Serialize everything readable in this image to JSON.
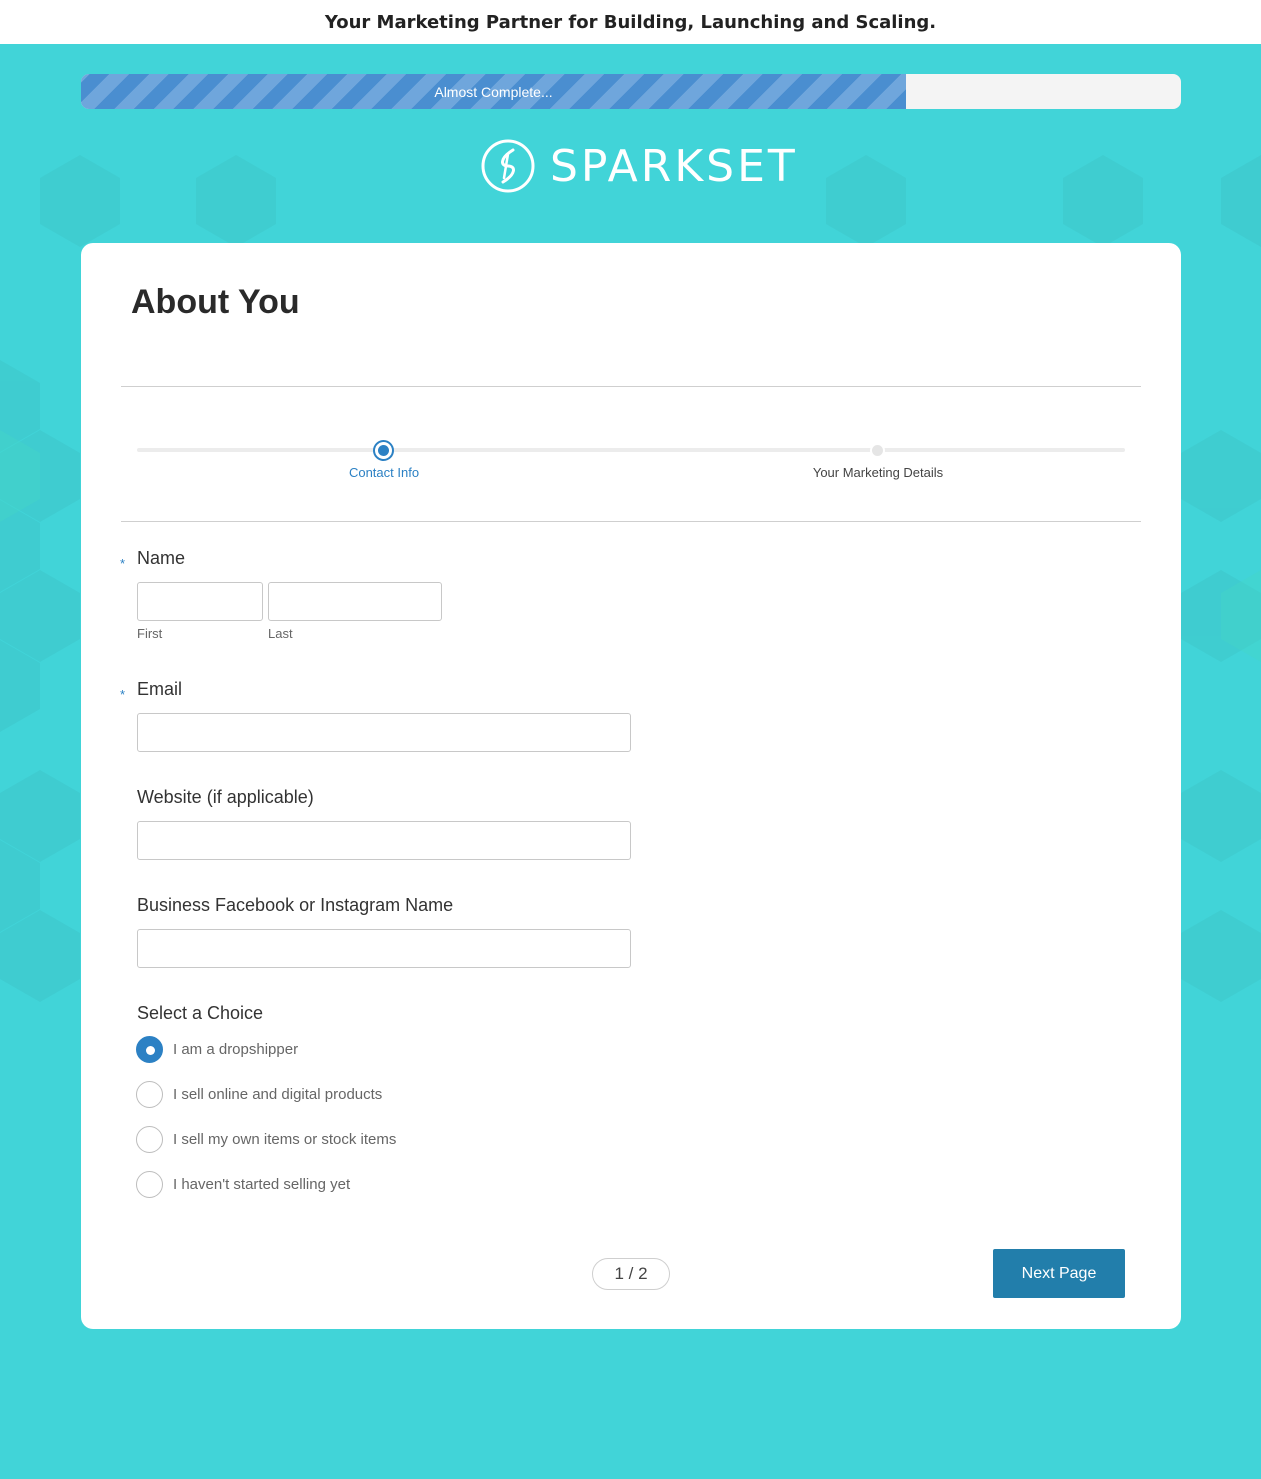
{
  "banner": {
    "text": "Your Marketing Partner for Building, Launching and Scaling."
  },
  "progress": {
    "label": "Almost Complete...",
    "percent": 75
  },
  "logo": {
    "text": "SPARKSET"
  },
  "form": {
    "title": "About You",
    "steps": [
      {
        "label": "Contact Info",
        "active": true
      },
      {
        "label": "Your Marketing Details",
        "active": false
      }
    ],
    "name": {
      "label": "Name",
      "required_mark": "*",
      "first_label": "First",
      "last_label": "Last",
      "first_value": "",
      "last_value": ""
    },
    "email": {
      "label": "Email",
      "required_mark": "*",
      "value": ""
    },
    "website": {
      "label": "Website (if applicable)",
      "value": ""
    },
    "social": {
      "label": "Business Facebook or Instagram Name",
      "value": ""
    },
    "choice": {
      "label": "Select a Choice",
      "options": [
        {
          "label": "I am a dropshipper",
          "checked": true
        },
        {
          "label": "I sell online and digital products",
          "checked": false
        },
        {
          "label": "I sell my own items or stock items",
          "checked": false
        },
        {
          "label": "I haven't started selling yet",
          "checked": false
        }
      ]
    },
    "pager": "1 / 2",
    "next_label": "Next Page"
  },
  "colors": {
    "background": "#41d4d8",
    "accent": "#2c81c4",
    "button": "#227eab"
  }
}
